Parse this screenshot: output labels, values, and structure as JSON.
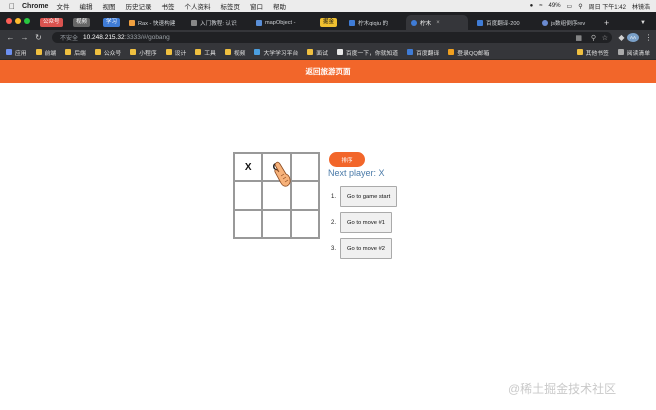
{
  "menubar": {
    "app": "Chrome",
    "items": [
      "文件",
      "编辑",
      "视图",
      "历史记录",
      "书签",
      "个人资料",
      "标签页",
      "窗口",
      "帮助"
    ],
    "battery": "49%",
    "datetime": "周日 下午1:42",
    "user": "林镜浩"
  },
  "tabs": [
    {
      "tag": "公众号",
      "tag_color": "#d9534f",
      "label": ""
    },
    {
      "tag": "视频",
      "tag_color": "#666666",
      "label": ""
    },
    {
      "tag": "学习",
      "tag_color": "#3f7cd6",
      "label": ""
    },
    {
      "tag": "",
      "label": "Rax - 快速构建"
    },
    {
      "tag": "",
      "label": "入门教程: 认识"
    },
    {
      "tag": "",
      "label": "mapObject -"
    },
    {
      "tag": "掘金",
      "tag_color": "#f0c030",
      "label": ""
    },
    {
      "tag": "",
      "label": "柠木qiqiu 的"
    },
    {
      "tag": "",
      "label": "柠木"
    },
    {
      "tag": "",
      "label": "百度翻译-200"
    },
    {
      "tag": "",
      "label": "js数组倒序rev"
    }
  ],
  "address": {
    "insecure_label": "不安全",
    "host": "10.248.215.32",
    "path": ":3333/#/gobang"
  },
  "bookmarks": [
    {
      "label": "应用",
      "color": "#6c8ff0"
    },
    {
      "label": "前端",
      "color": "#f0c040"
    },
    {
      "label": "后端",
      "color": "#f0c040"
    },
    {
      "label": "公众号",
      "color": "#f0c040"
    },
    {
      "label": "小程序",
      "color": "#f0c040"
    },
    {
      "label": "设计",
      "color": "#f0c040"
    },
    {
      "label": "工具",
      "color": "#f0c040"
    },
    {
      "label": "视频",
      "color": "#f0c040"
    },
    {
      "label": "大学学习平台",
      "color": "#4b9fe0"
    },
    {
      "label": "面试",
      "color": "#f0c040"
    },
    {
      "label": "百度一下，你就知道",
      "color": "#e8e8e8"
    },
    {
      "label": "百度翻译",
      "color": "#3f7cd6"
    },
    {
      "label": "登录QQ邮箱",
      "color": "#f0a020"
    }
  ],
  "bookmarks_right": [
    "其他书签",
    "阅读清单"
  ],
  "page": {
    "title": "返回旅游页面",
    "sort_label": "排序",
    "status": "Next player: X",
    "board": [
      "X",
      "O",
      "",
      "",
      "",
      "",
      "",
      "",
      ""
    ],
    "moves": [
      {
        "num": "1.",
        "label": "Go to game start"
      },
      {
        "num": "2.",
        "label": "Go to move #1"
      },
      {
        "num": "3.",
        "label": "Go to move #2"
      }
    ]
  },
  "watermark": "@稀土掘金技术社区"
}
